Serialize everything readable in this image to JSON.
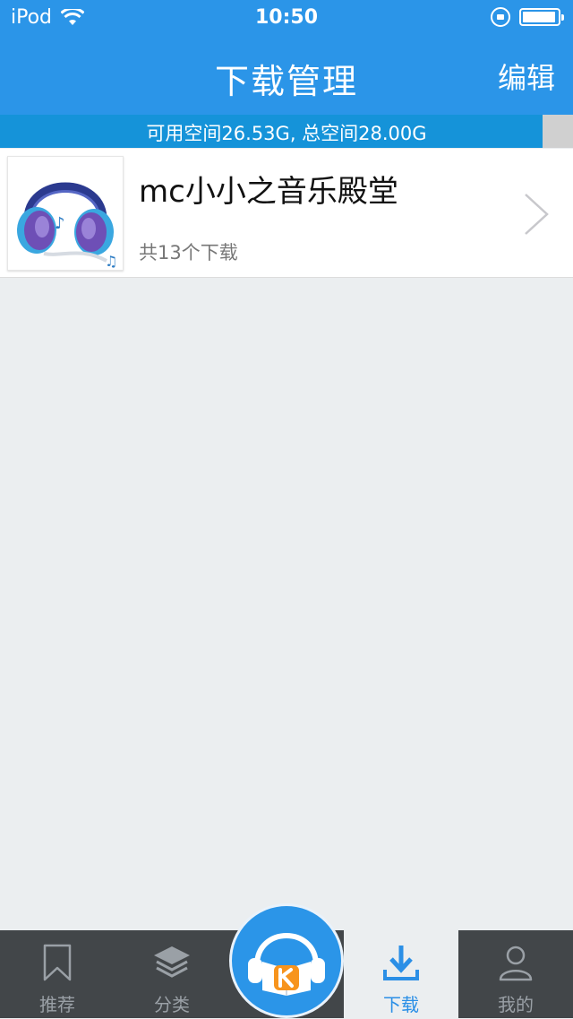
{
  "status_bar": {
    "carrier": "iPod",
    "time": "10:50"
  },
  "nav": {
    "title": "下载管理",
    "edit_label": "编辑"
  },
  "storage": {
    "text": "可用空间26.53G, 总空间28.00G",
    "used_fraction": 0.947
  },
  "downloads": [
    {
      "title": "mc小小之音乐殿堂",
      "subtitle": "共13个下载"
    }
  ],
  "tabbar": {
    "tabs": [
      {
        "label": "推荐",
        "icon": "bookmark-icon"
      },
      {
        "label": "分类",
        "icon": "layers-icon"
      },
      {
        "label": "下载",
        "icon": "download-icon",
        "active": true
      },
      {
        "label": "我的",
        "icon": "user-icon"
      }
    ],
    "center_icon": "headphones-book-logo-icon"
  },
  "colors": {
    "header": "#2b95e8",
    "storage": "#1593d9",
    "active_tab": "#2b8fe6",
    "tabbar": "#424649"
  }
}
